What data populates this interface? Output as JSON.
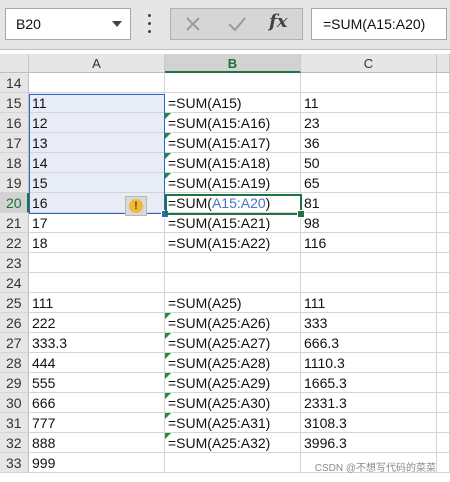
{
  "formula_bar": {
    "name_box": "B20",
    "formula": "=SUM(A15:A20)",
    "fx_label": "fx"
  },
  "columns": [
    "A",
    "B",
    "C"
  ],
  "rows": [
    {
      "num": "14",
      "a": "",
      "b": "",
      "c": ""
    },
    {
      "num": "15",
      "a": "11",
      "b": "=SUM(A15)",
      "c": "11"
    },
    {
      "num": "16",
      "a": "12",
      "b": "=SUM(A15:A16)",
      "c": "23"
    },
    {
      "num": "17",
      "a": "13",
      "b": "=SUM(A15:A17)",
      "c": "36"
    },
    {
      "num": "18",
      "a": "14",
      "b": "=SUM(A15:A18)",
      "c": "50"
    },
    {
      "num": "19",
      "a": "15",
      "b": "=SUM(A15:A19)",
      "c": "65"
    },
    {
      "num": "20",
      "a": "16",
      "b": "=SUM(A15:A20)",
      "c": "81"
    },
    {
      "num": "21",
      "a": "17",
      "b": "=SUM(A15:A21)",
      "c": "98"
    },
    {
      "num": "22",
      "a": "18",
      "b": "=SUM(A15:A22)",
      "c": "116"
    },
    {
      "num": "23",
      "a": "",
      "b": "",
      "c": ""
    },
    {
      "num": "24",
      "a": "",
      "b": "",
      "c": ""
    },
    {
      "num": "25",
      "a": "111",
      "b": "=SUM(A25)",
      "c": "111"
    },
    {
      "num": "26",
      "a": "222",
      "b": "=SUM(A25:A26)",
      "c": "333"
    },
    {
      "num": "27",
      "a": "333.3",
      "b": "=SUM(A25:A27)",
      "c": "666.3"
    },
    {
      "num": "28",
      "a": "444",
      "b": "=SUM(A25:A28)",
      "c": "1110.3"
    },
    {
      "num": "29",
      "a": "555",
      "b": "=SUM(A25:A29)",
      "c": "1665.3"
    },
    {
      "num": "30",
      "a": "666",
      "b": "=SUM(A25:A30)",
      "c": "2331.3"
    },
    {
      "num": "31",
      "a": "777",
      "b": "=SUM(A25:A31)",
      "c": "3108.3"
    },
    {
      "num": "32",
      "a": "888",
      "b": "=SUM(A25:A32)",
      "c": "3996.3"
    },
    {
      "num": "33",
      "a": "999",
      "b": "",
      "c": ""
    }
  ],
  "active_cell_formula": {
    "prefix": "=SUM(",
    "ref": "A15:A20",
    "suffix": ")"
  },
  "warning_icon": "!",
  "watermark": "CSDN @不想写代码的菜菜",
  "colors": {
    "accent": "#217346",
    "selection": "#2b67c6",
    "selection_fill": "#e7ecf6"
  }
}
